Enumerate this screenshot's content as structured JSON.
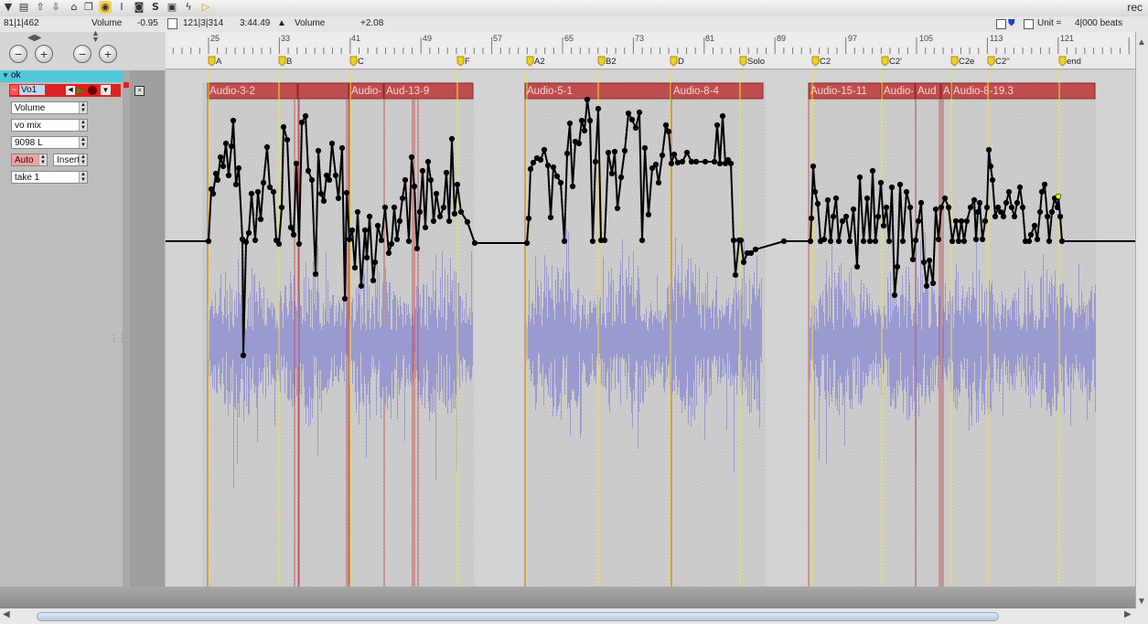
{
  "window": {
    "title": "rec"
  },
  "toolbar": {
    "icons": [
      "menu-triangle-icon",
      "document-icon",
      "arrow-up-icon",
      "arrow-down-icon",
      "home-icon",
      "copy-icon",
      "cursor-icon",
      "text-cursor-icon",
      "camera-icon",
      "solo-s-icon",
      "window-icon",
      "lightning-icon",
      "play-icon"
    ]
  },
  "infobar": {
    "position": "81|1|462",
    "param_label": "Volume",
    "param_value": "-0.95",
    "sel_pos": "121|3|314",
    "sel_time": "3:44.49",
    "sel_param": "Volume",
    "sel_value": "+2.08",
    "unit_label": "Unit =",
    "unit_value": "4|000 beats"
  },
  "ruler": {
    "bars": [
      "25",
      "33",
      "41",
      "49",
      "57",
      "65",
      "73",
      "81",
      "89",
      "97",
      "105",
      "113",
      "121"
    ]
  },
  "markers": [
    "A",
    "B",
    "C",
    "F",
    "A2",
    "B2",
    "D",
    "Solo",
    "C2",
    "C2'",
    "C2e",
    "C2''",
    "end"
  ],
  "track": {
    "folder": "ok",
    "name": "Vo1",
    "param": "Volume",
    "bus": "vo mix",
    "pan": "9098 L",
    "auto": "Auto",
    "mode": "Insert",
    "take": "take 1"
  },
  "regions": [
    "Audio-3-2",
    "Audio-",
    "Aud",
    "-13-9",
    "Audio-5-1",
    "Audio-8-4",
    "Audio-15-11",
    "Audio-",
    "Aud",
    "A",
    "Audio-8-19.3"
  ],
  "colors": {
    "region": "#c04d4d",
    "waveform": "#9a9ad0",
    "automation": "#000000",
    "marker_line": "#f0e040",
    "track_header": "#52c9d8"
  }
}
